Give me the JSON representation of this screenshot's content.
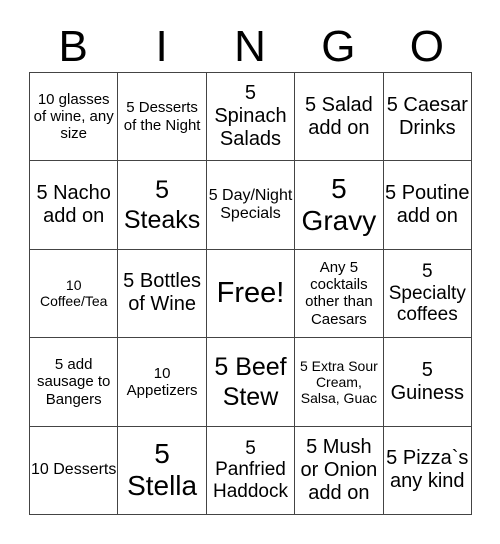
{
  "header": {
    "letters": [
      "B",
      "I",
      "N",
      "G",
      "O"
    ]
  },
  "cells": [
    [
      "10 glasses of wine, any size",
      "5 Desserts of the Night",
      "5 Spinach Salads",
      "5 Salad add on",
      "5 Caesar Drinks"
    ],
    [
      "5 Nacho add on",
      "5 Steaks",
      "5 Day/Night Specials",
      "5 Gravy",
      "5 Poutine add on"
    ],
    [
      "10 Coffee/Tea",
      "5 Bottles of Wine",
      "Free!",
      "Any 5 cocktails other than Caesars",
      "5 Specialty coffees"
    ],
    [
      "5 add sausage to Bangers",
      "10 Appetizers",
      "5 Beef Stew",
      "5 Extra Sour Cream, Salsa, Guac",
      "5 Guiness"
    ],
    [
      "10 Desserts",
      "5 Stella",
      "5 Panfried Haddock",
      "5 Mush or Onion add on",
      "5 Pizza`s any kind"
    ]
  ]
}
